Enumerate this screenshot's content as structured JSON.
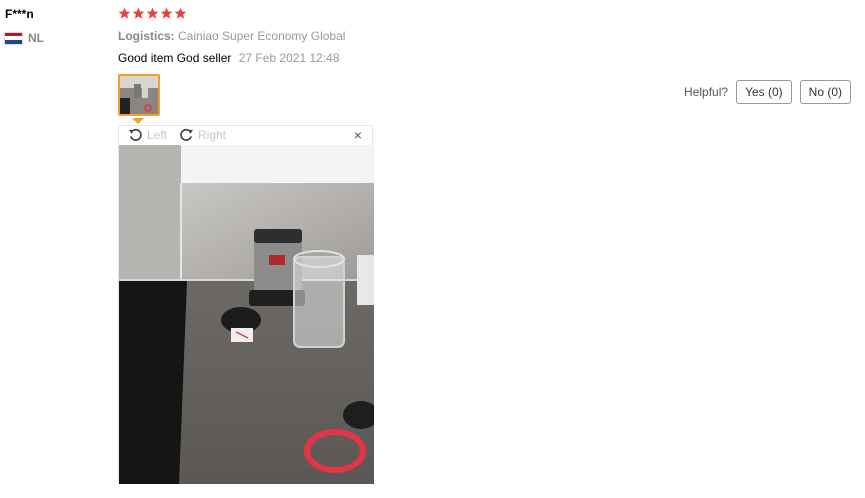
{
  "reviewer": {
    "name": "F***n",
    "country": "NL",
    "flag_colors": [
      "#ae1c28",
      "#ffffff",
      "#21468b"
    ]
  },
  "rating": {
    "stars": 5,
    "max": 5,
    "color": "#e64340"
  },
  "logistics": {
    "label": "Logistics:",
    "value": "Cainiao Super Economy Global"
  },
  "review": {
    "text": "Good item God seller",
    "date": "27 Feb 2021 12:48"
  },
  "viewer": {
    "rotate_left": "Left",
    "rotate_right": "Right",
    "close": "×"
  },
  "helpful": {
    "label": "Helpful?",
    "yes": "Yes (0)",
    "no": "No (0)"
  },
  "colors": {
    "thumb_border": "#f0a030"
  }
}
